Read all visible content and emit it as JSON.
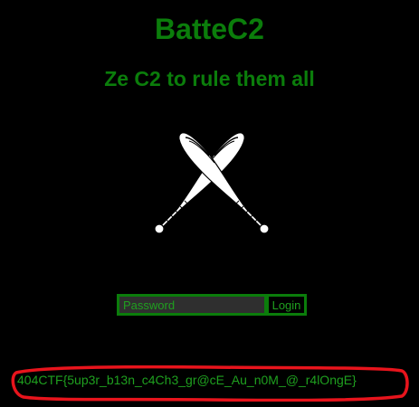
{
  "app": {
    "title": "BatteC2",
    "subtitle": "Ze C2 to rule them all"
  },
  "logo": {
    "icon": "crossed-baseball-bats-icon"
  },
  "login": {
    "password_placeholder": "Password",
    "password_value": "",
    "button_label": "Login"
  },
  "flag": {
    "text": "404CTF{5up3r_b13n_c4Ch3_gr@cE_Au_n0M_@_r4lOngE}"
  },
  "colors": {
    "background": "#000000",
    "accent": "#0b7d0b",
    "text_green": "#1fa01f",
    "input_bg": "#2f2f2f",
    "annotation": "#e8141c",
    "logo": "#ffffff"
  }
}
